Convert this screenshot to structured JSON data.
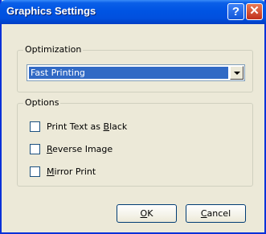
{
  "window": {
    "title": "Graphics Settings"
  },
  "titlebar": {
    "help_label": "?",
    "close_label": "✕"
  },
  "optimization": {
    "label": "Optimization",
    "selected_value": "Fast Printing"
  },
  "options": {
    "label": "Options",
    "items": [
      {
        "pre": "Print Text as ",
        "accel": "B",
        "post": "lack",
        "checked": false
      },
      {
        "pre": "",
        "accel": "R",
        "post": "everse Image",
        "checked": false
      },
      {
        "pre": "",
        "accel": "M",
        "post": "irror Print",
        "checked": false
      }
    ]
  },
  "buttons": {
    "ok": {
      "accel": "O",
      "rest": "K"
    },
    "cancel": {
      "accel": "C",
      "rest": "ancel"
    }
  },
  "icons": {
    "dropdown": "chevron-down-icon",
    "help": "help-icon",
    "close": "close-icon"
  }
}
